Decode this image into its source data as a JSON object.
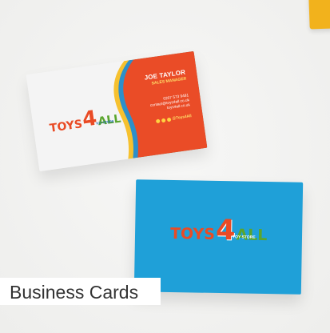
{
  "caption": {
    "label": "Business Cards"
  },
  "brand": {
    "logo_parts": [
      "TOYS",
      "4",
      "ALL"
    ],
    "subtitle": "TOY STORE"
  },
  "front_card": {
    "name": "JOE TAYLOR",
    "title": "SALES MANAGER",
    "phone": "0207 573 9481",
    "email": "contact@toys4all.co.uk",
    "website": "toys4all.co.uk",
    "social_handle": "@Toys4All"
  },
  "colors": {
    "card_blue": "#1fa0d8",
    "card_orange": "#ea4c27",
    "accent_yellow": "#f6c12f",
    "background": "#f3f3f2"
  },
  "icons": {
    "social_icons": [
      "facebook-icon",
      "twitter-icon",
      "instagram-icon"
    ]
  }
}
